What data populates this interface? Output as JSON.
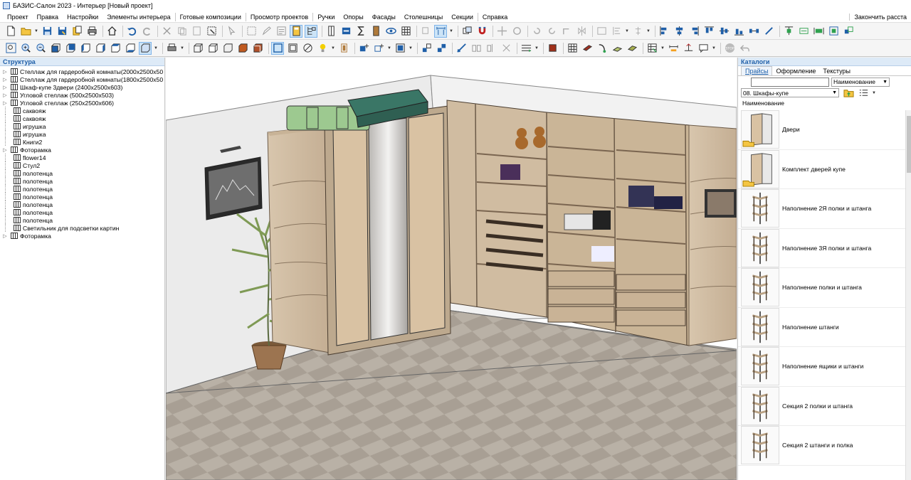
{
  "window": {
    "title": "БАЗИС-Салон 2023 - Интерьер [Новый проект]"
  },
  "menu": {
    "items": [
      "Проект",
      "Правка",
      "Настройки",
      "Элементы интерьера",
      "Готовые композиции",
      "Просмотр проектов",
      "Ручки",
      "Опоры",
      "Фасады",
      "Столешницы",
      "Секции",
      "Справка"
    ],
    "right_action": "Закончить расста"
  },
  "structure": {
    "title": "Структура",
    "items": [
      {
        "label": "Стеллаж для гардеробной комнаты(2000x2500x50",
        "expandable": true
      },
      {
        "label": "Стеллаж для гардеробной комнаты(1800x2500x50",
        "expandable": true
      },
      {
        "label": "Шкаф-купе 3двери (2400x2500x603)",
        "expandable": true
      },
      {
        "label": "Угловой стеллаж (500x2500x503)",
        "expandable": true
      },
      {
        "label": "Угловой стеллаж (250x2500x606)",
        "expandable": true
      },
      {
        "label": "саквояж",
        "expandable": false
      },
      {
        "label": "саквояж",
        "expandable": false
      },
      {
        "label": "игрушка",
        "expandable": false
      },
      {
        "label": "игрушка",
        "expandable": false
      },
      {
        "label": "Книги2",
        "expandable": false
      },
      {
        "label": "Фоторамка",
        "expandable": true
      },
      {
        "label": "flower14",
        "expandable": false
      },
      {
        "label": "Стул2",
        "expandable": false
      },
      {
        "label": "полотенца",
        "expandable": false
      },
      {
        "label": "полотенца",
        "expandable": false
      },
      {
        "label": "полотенца",
        "expandable": false
      },
      {
        "label": "полотенца",
        "expandable": false
      },
      {
        "label": "полотенца",
        "expandable": false
      },
      {
        "label": "полотенца",
        "expandable": false
      },
      {
        "label": "полотенца",
        "expandable": false
      },
      {
        "label": "Светильник для подсветки картин",
        "expandable": false
      },
      {
        "label": "Фоторамка",
        "expandable": true
      }
    ]
  },
  "catalogs": {
    "title": "Каталоги",
    "tabs": [
      {
        "label": "Прайсы",
        "active": true
      },
      {
        "label": "Оформление",
        "active": false
      },
      {
        "label": "Текстуры",
        "active": false
      }
    ],
    "search": {
      "value": "",
      "placeholder": ""
    },
    "sort_field": "Наименование",
    "category": "08. Шкафы-купе",
    "column_header": "Наименование",
    "items": [
      {
        "label": "Двери",
        "folder": true
      },
      {
        "label": "Комплект дверей купе",
        "folder": true
      },
      {
        "label": "Наполнение 2Я полки и штанга",
        "folder": false
      },
      {
        "label": "Наполнение 3Я полки и штанга",
        "folder": false
      },
      {
        "label": "Наполнение полки и штанга",
        "folder": false
      },
      {
        "label": "Наполнение штанги",
        "folder": false
      },
      {
        "label": "Наполнение ящики и штанги",
        "folder": false
      },
      {
        "label": "Секция 2 полки и штанга",
        "folder": false
      },
      {
        "label": "Секция 2 штанги и полка",
        "folder": false
      }
    ]
  },
  "colors": {
    "panel_header_bg": "#ddeaf7",
    "panel_header_text": "#1f5fa8",
    "accent": "#1f5fa8",
    "wood": "#cdb79a",
    "floor": "#a39b90"
  },
  "toolbar_icons": {
    "row1": [
      "new-file",
      "open-folder",
      "save",
      "save-as",
      "copy-project",
      "print",
      "home",
      "undo",
      "redo",
      "cut",
      "copy",
      "paste",
      "select",
      "pointer",
      "group",
      "edit",
      "snap",
      "grid",
      "bars",
      "magnet",
      "rotate",
      "mirror",
      "align"
    ],
    "row2": [
      "zoom-fit",
      "zoom-in",
      "zoom-out",
      "view-front",
      "view-back",
      "view-left",
      "view-right",
      "view-top",
      "view-iso",
      "print",
      "wireframe",
      "solid",
      "texture",
      "light",
      "render"
    ]
  }
}
